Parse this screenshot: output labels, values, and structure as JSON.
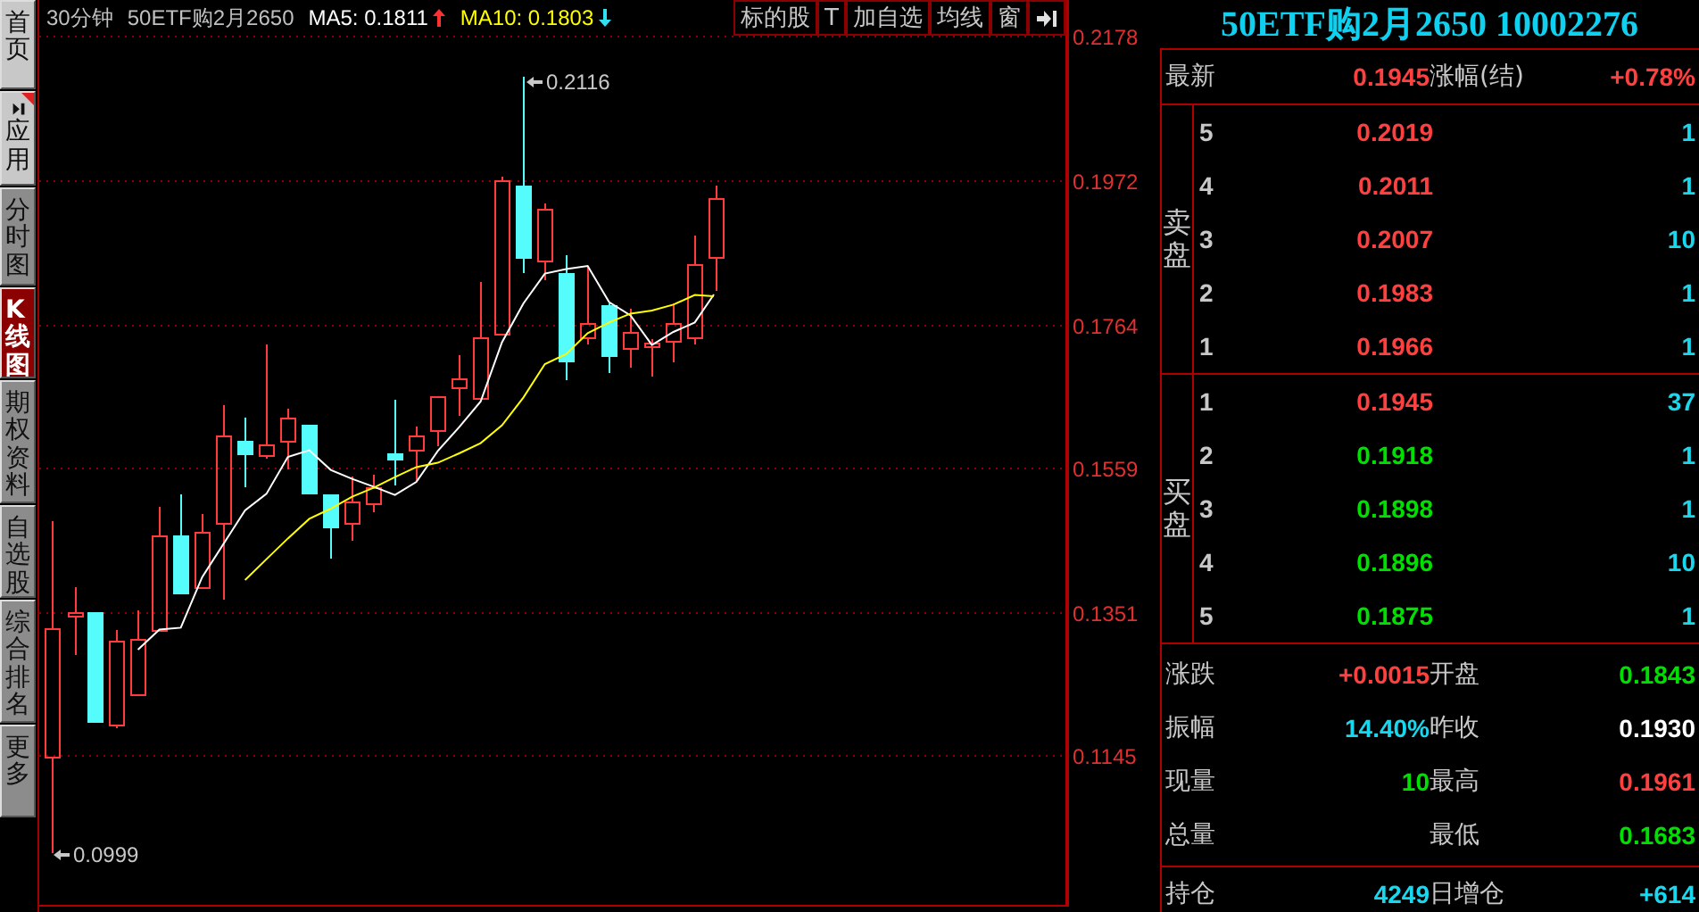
{
  "sidebar": {
    "tabs": [
      {
        "label": "首页",
        "kind": "light",
        "selected": false
      },
      {
        "label": "应用",
        "kind": "app",
        "selected": false
      },
      {
        "label": "分时图",
        "kind": "dark",
        "selected": false
      },
      {
        "label": "K线图",
        "kind": "dark",
        "selected": true
      },
      {
        "label": "期权资料",
        "kind": "dark",
        "selected": false
      },
      {
        "label": "自选股",
        "kind": "dark",
        "selected": false
      },
      {
        "label": "综合排名",
        "kind": "dark",
        "selected": false
      },
      {
        "label": "更多",
        "kind": "dark",
        "selected": false
      }
    ]
  },
  "chart": {
    "period": "30分钟",
    "name": "50ETF购2月2650",
    "moving_averages": [
      {
        "label": "MA5: 0.1811",
        "rising": true,
        "color": "#ffffff"
      },
      {
        "label": "MA10: 0.1803",
        "rising": false,
        "color": "#ffff00"
      }
    ],
    "buttons": [
      "标的股",
      "T",
      "加自选",
      "均线",
      "窗"
    ],
    "y_axis_labels": [
      "0.2178",
      "0.1972",
      "0.1764",
      "0.1559",
      "0.1351",
      "0.1145"
    ],
    "high_marker": "0.2116",
    "low_marker": "0.0999"
  },
  "quote": {
    "title": "50ETF购2月2650 10002276",
    "latest": [
      {
        "label": "最新",
        "value": "0.1945",
        "color": "#ff4040"
      },
      {
        "label": "涨幅(结)",
        "value": "+0.78%",
        "color": "#ff4040"
      }
    ],
    "asks": {
      "label": "卖盘",
      "levels": [
        {
          "level": "5",
          "price": "0.2019",
          "volume": "1",
          "color": "#ff4040"
        },
        {
          "level": "4",
          "price": "0.2011",
          "volume": "1",
          "color": "#ff4040"
        },
        {
          "level": "3",
          "price": "0.2007",
          "volume": "10",
          "color": "#ff4040"
        },
        {
          "level": "2",
          "price": "0.1983",
          "volume": "1",
          "color": "#ff4040"
        },
        {
          "level": "1",
          "price": "0.1966",
          "volume": "1",
          "color": "#ff4040"
        }
      ]
    },
    "bids": {
      "label": "买盘",
      "levels": [
        {
          "level": "1",
          "price": "0.1945",
          "volume": "37",
          "color": "#ff4040"
        },
        {
          "level": "2",
          "price": "0.1918",
          "volume": "1",
          "color": "#00e000"
        },
        {
          "level": "3",
          "price": "0.1898",
          "volume": "1",
          "color": "#00e000"
        },
        {
          "level": "4",
          "price": "0.1896",
          "volume": "10",
          "color": "#00e000"
        },
        {
          "level": "5",
          "price": "0.1875",
          "volume": "1",
          "color": "#00e000"
        }
      ]
    },
    "stats": [
      [
        {
          "label": "涨跌",
          "value": "+0.0015",
          "color": "#ff4040"
        },
        {
          "label": "开盘",
          "value": "0.1843",
          "color": "#00e000"
        }
      ],
      [
        {
          "label": "振幅",
          "value": "14.40%",
          "color": "#18d8f0"
        },
        {
          "label": "昨收",
          "value": "0.1930",
          "color": "#ffffff"
        }
      ],
      [
        {
          "label": "现量",
          "value": "10",
          "color": "#00e000"
        },
        {
          "label": "最高",
          "value": "0.1961",
          "color": "#ff4040"
        }
      ],
      [
        {
          "label": "总量"
        },
        {
          "label": "最低",
          "value": "0.1683",
          "color": "#00e000"
        }
      ]
    ],
    "position": [
      {
        "label": "持仓",
        "value": "4249",
        "color": "#18d8f0"
      },
      {
        "label": "日增仓",
        "value": "+614",
        "color": "#18d8f0"
      }
    ]
  }
}
